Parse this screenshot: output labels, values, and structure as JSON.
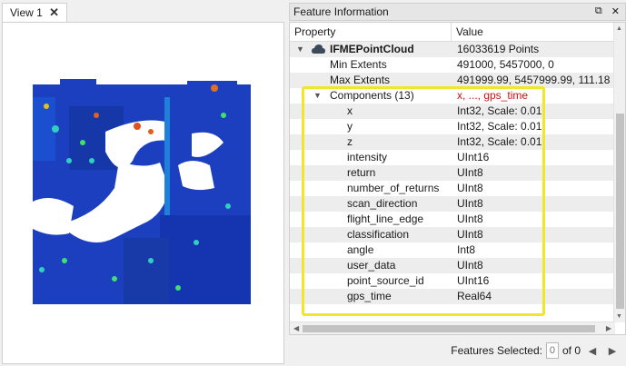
{
  "view": {
    "tab_label": "View 1",
    "close_glyph": "✕"
  },
  "panel": {
    "title": "Feature Information",
    "restore_glyph": "⧉",
    "close_glyph": "✕",
    "columns": {
      "property": "Property",
      "value": "Value"
    },
    "rows": [
      {
        "property": "IFMEPointCloud",
        "value": "16033619 Points",
        "level": 0,
        "expander": "collapse",
        "bold": true,
        "icon": "cloud-icon"
      },
      {
        "property": "Min Extents",
        "value": "491000, 5457000, 0",
        "level": 1
      },
      {
        "property": "Max Extents",
        "value": "491999.99, 5457999.99, 111.18",
        "level": 1
      },
      {
        "property": "Components (13)",
        "value": "x, ..., gps_time",
        "level": 1,
        "expander": "collapse",
        "value_color": "#d01010"
      },
      {
        "property": "x",
        "value": "Int32, Scale: 0.01",
        "level": 2
      },
      {
        "property": "y",
        "value": "Int32, Scale: 0.01",
        "level": 2
      },
      {
        "property": "z",
        "value": "Int32, Scale: 0.01",
        "level": 2
      },
      {
        "property": "intensity",
        "value": "UInt16",
        "level": 2
      },
      {
        "property": "return",
        "value": "UInt8",
        "level": 2
      },
      {
        "property": "number_of_returns",
        "value": "UInt8",
        "level": 2
      },
      {
        "property": "scan_direction",
        "value": "UInt8",
        "level": 2
      },
      {
        "property": "flight_line_edge",
        "value": "UInt8",
        "level": 2
      },
      {
        "property": "classification",
        "value": "UInt8",
        "level": 2
      },
      {
        "property": "angle",
        "value": "Int8",
        "level": 2
      },
      {
        "property": "user_data",
        "value": "UInt8",
        "level": 2
      },
      {
        "property": "point_source_id",
        "value": "UInt16",
        "level": 2
      },
      {
        "property": "gps_time",
        "value": "Real64",
        "level": 2
      }
    ]
  },
  "footer": {
    "label": "Features Selected:",
    "selected": "0",
    "of_label": "of 0",
    "prev_glyph": "◀",
    "next_glyph": "▶"
  },
  "colors": {
    "highlight": "#f2e62a",
    "point_cloud": "#1a3fbf",
    "red_text": "#d01010"
  }
}
